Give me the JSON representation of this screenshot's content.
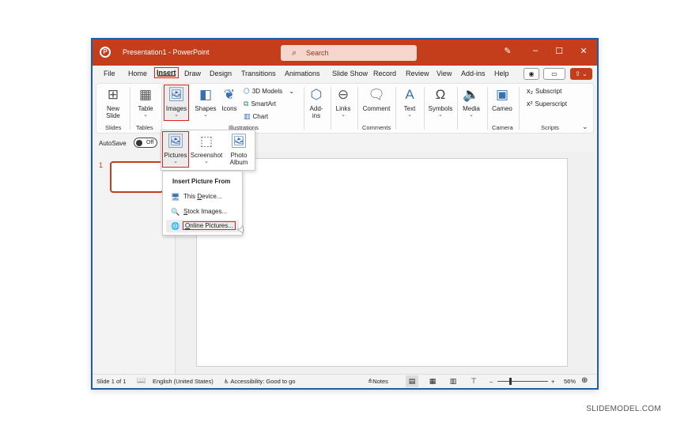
{
  "titlebar": {
    "title": "Presentation1 - PowerPoint",
    "search_placeholder": "Search",
    "app_icon": "powerpoint-logo-icon",
    "icons": [
      "pen-icon",
      "minimize-icon",
      "maximize-icon",
      "close-icon"
    ],
    "glyphs": {
      "pen": "✎",
      "minimize": "–",
      "maximize": "☐",
      "close": "✕",
      "search": "⌕",
      "logo": "P"
    }
  },
  "menu": {
    "tabs": [
      "File",
      "Home",
      "Insert",
      "Draw",
      "Design",
      "Transitions",
      "Animations",
      "Slide Show",
      "Record",
      "Review",
      "View",
      "Add-ins",
      "Help"
    ],
    "active_tab": "Insert",
    "record_glyph": "◉",
    "comment_glyph": "▭",
    "share_glyph": "⇪ ⌄"
  },
  "ribbon": {
    "new_slide": "New Slide",
    "table": "Table",
    "images": "Images",
    "shapes": "Shapes",
    "icons": "Icons",
    "models_3d": "3D Models",
    "smartart": "SmartArt",
    "chart": "Chart",
    "addins": "Add-ins",
    "links": "Links",
    "comment": "Comment",
    "text": "Text",
    "symbols": "Symbols",
    "media": "Media",
    "cameo": "Cameo",
    "subscript": "Subscript",
    "superscript": "Superscript",
    "groups": {
      "slides": "Slides",
      "tables": "Tables",
      "illustrations": "Illustrations",
      "comments": "Comments",
      "camera": "Camera",
      "scripts": "Scripts"
    },
    "chevron": "⌄"
  },
  "qat": {
    "autosave_label": "AutoSave",
    "autosave_state": "Off"
  },
  "images_dropdown": {
    "pictures": "Pictures",
    "screenshot": "Screenshot",
    "photo_album": "Photo Album"
  },
  "pictures_menu": {
    "header": "Insert Picture From",
    "items": [
      {
        "pre": "This ",
        "key": "D",
        "post": "evice..."
      },
      {
        "pre": "",
        "key": "S",
        "post": "tock Images..."
      },
      {
        "pre": "",
        "key": "O",
        "post": "nline Pictures..."
      }
    ]
  },
  "thumbs": {
    "slide_number": "1"
  },
  "status": {
    "slide_info": "Slide 1 of 1",
    "language": "English (United States)",
    "accessibility": "Accessibility: Good to go",
    "notes": "Notes",
    "zoom_level": "56%",
    "zoom_percent": 56,
    "zoom_minus": "–",
    "zoom_plus": "+"
  },
  "watermark": "SLIDEMODEL.COM"
}
